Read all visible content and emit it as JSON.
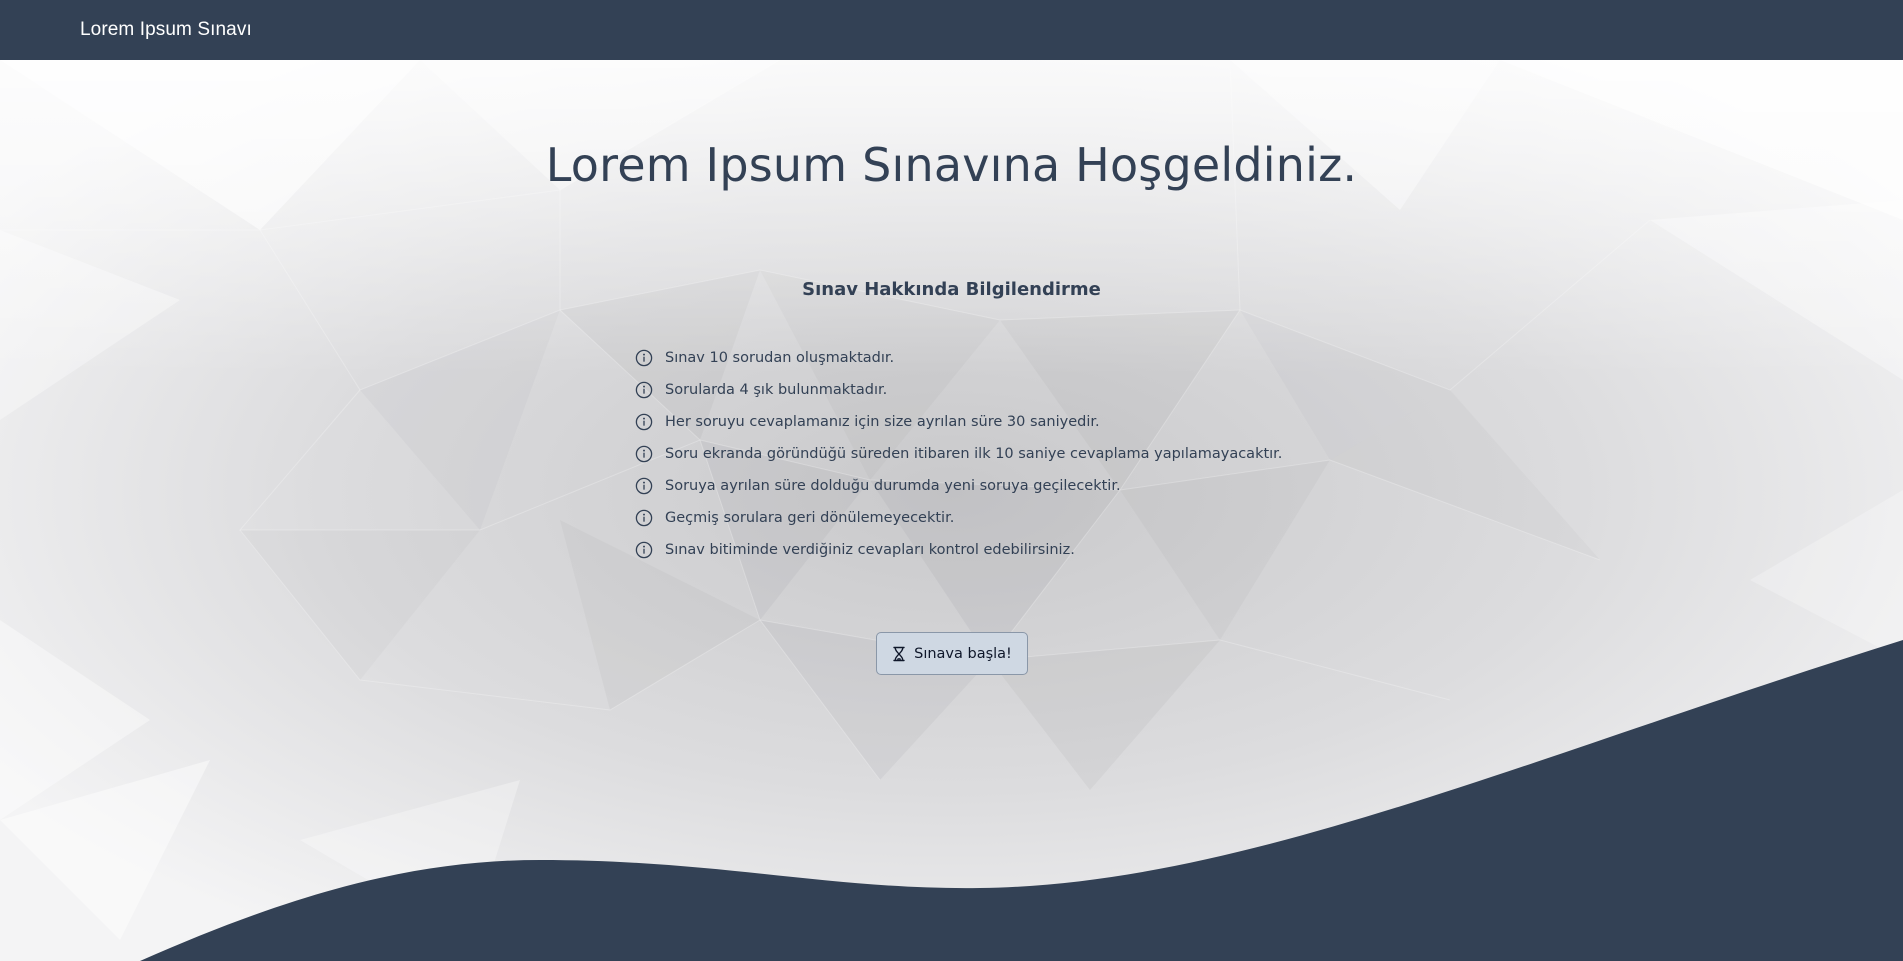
{
  "navbar": {
    "brand": "Lorem Ipsum Sınavı"
  },
  "main": {
    "title": "Lorem Ipsum Sınavına Hoşgeldiniz.",
    "info_heading": "Sınav Hakkında Bilgilendirme",
    "info_items": [
      {
        "icon": "info-circle-icon",
        "text": "Sınav 10 sorudan oluşmaktadır."
      },
      {
        "icon": "info-circle-icon",
        "text": "Sorularda 4 şık bulunmaktadır."
      },
      {
        "icon": "info-circle-icon",
        "text": "Her soruyu cevaplamanız için size ayrılan süre 30 saniyedir."
      },
      {
        "icon": "info-circle-icon",
        "text": "Soru ekranda göründüğü süreden itibaren ilk 10 saniye cevaplama yapılamayacaktır."
      },
      {
        "icon": "info-circle-icon",
        "text": "Soruya ayrılan süre dolduğu durumda yeni soruya geçilecektir."
      },
      {
        "icon": "info-circle-icon",
        "text": "Geçmiş sorulara geri dönülemeyecektir."
      },
      {
        "icon": "info-circle-icon",
        "text": "Sınav bitiminde verdiğiniz cevapları kontrol edebilirsiniz."
      }
    ],
    "start_button": {
      "icon": "hourglass-icon",
      "label": "Sınava başla!"
    }
  },
  "colors": {
    "navbar_bg": "#334155",
    "wave_fill": "#334155",
    "text_primary": "#334155",
    "button_bg": "#cfd8e3",
    "button_border": "#8a97a8"
  }
}
